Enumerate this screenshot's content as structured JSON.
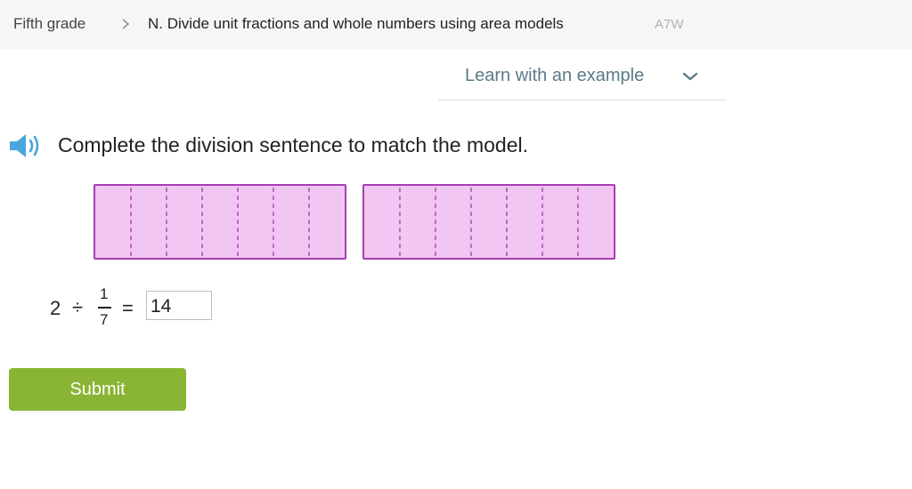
{
  "breadcrumb": {
    "grade": "Fifth grade",
    "skill": "N. Divide unit fractions and whole numbers using area models",
    "code": "A7W"
  },
  "learn": {
    "label": "Learn with an example"
  },
  "question": {
    "prompt": "Complete the division sentence to match the model.",
    "model": {
      "wholes": 2,
      "parts_per_whole": 7,
      "fill_color": "#f2c6f2",
      "border_color": "#a83db1"
    },
    "equation": {
      "whole": "2",
      "divide_sign": "÷",
      "fraction_numerator": "1",
      "fraction_denominator": "7",
      "equals_sign": "="
    },
    "answer_value": "14"
  },
  "actions": {
    "submit_label": "Submit"
  },
  "colors": {
    "submit": "#8ab534",
    "speaker": "#4aa6dd",
    "link": "#5b7a86"
  }
}
